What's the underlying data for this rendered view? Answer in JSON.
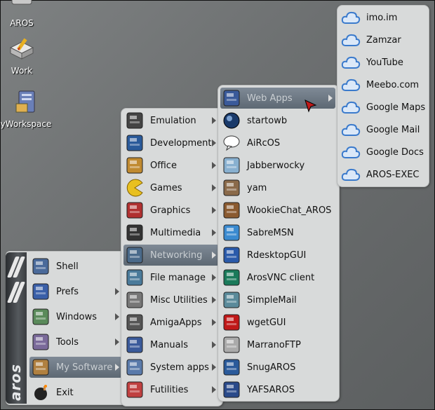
{
  "desktop": {
    "icons": [
      {
        "label": "AROS",
        "icon": "aros-drive-icon"
      },
      {
        "label": "Work",
        "icon": "work-drive-icon"
      },
      {
        "label": "yWorkspace",
        "icon": "workspace-drive-icon"
      }
    ]
  },
  "start_menu": {
    "brand": "aros",
    "items": [
      {
        "label": "Shell",
        "icon": "shell-icon",
        "submenu": false
      },
      {
        "label": "Prefs",
        "icon": "prefs-icon",
        "submenu": true
      },
      {
        "label": "Windows",
        "icon": "windows-icon",
        "submenu": true
      },
      {
        "label": "Tools",
        "icon": "tools-icon",
        "submenu": true
      },
      {
        "label": "My Software",
        "icon": "my-software-icon",
        "submenu": true,
        "selected": true
      },
      {
        "label": "Exit",
        "icon": "exit-icon",
        "submenu": false
      }
    ]
  },
  "software_menu": {
    "items": [
      {
        "label": "Emulation",
        "icon": "emulation-icon"
      },
      {
        "label": "Development",
        "icon": "development-icon"
      },
      {
        "label": "Office",
        "icon": "office-icon"
      },
      {
        "label": "Games",
        "icon": "games-icon"
      },
      {
        "label": "Graphics",
        "icon": "graphics-icon"
      },
      {
        "label": "Multimedia",
        "icon": "multimedia-icon"
      },
      {
        "label": "Networking",
        "icon": "networking-icon",
        "selected": true
      },
      {
        "label": "File manage",
        "icon": "file-manage-icon"
      },
      {
        "label": "Misc Utilities",
        "icon": "misc-utilities-icon"
      },
      {
        "label": "AmigaApps",
        "icon": "amigaapps-icon"
      },
      {
        "label": "Manuals",
        "icon": "manuals-icon"
      },
      {
        "label": "System apps",
        "icon": "system-apps-icon"
      },
      {
        "label": "Futilities",
        "icon": "futilities-icon"
      }
    ]
  },
  "networking_menu": {
    "items": [
      {
        "label": "Web Apps",
        "icon": "web-apps-icon",
        "submenu": true,
        "selected": true
      },
      {
        "label": "startowb",
        "icon": "startowb-icon"
      },
      {
        "label": "AiRcOS",
        "icon": "aircos-icon"
      },
      {
        "label": "Jabberwocky",
        "icon": "jabberwocky-icon"
      },
      {
        "label": "yam",
        "icon": "yam-icon"
      },
      {
        "label": "WookieChat_AROS",
        "icon": "wookiechat-icon"
      },
      {
        "label": "SabreMSN",
        "icon": "sabremsn-icon"
      },
      {
        "label": "RdesktopGUI",
        "icon": "rdesktopgui-icon"
      },
      {
        "label": "ArosVNC client",
        "icon": "arosvnc-icon"
      },
      {
        "label": "SimpleMail",
        "icon": "simplemail-icon"
      },
      {
        "label": "wgetGUI",
        "icon": "wgetgui-icon"
      },
      {
        "label": "MarranoFTP",
        "icon": "marranoftp-icon"
      },
      {
        "label": "SnugAROS",
        "icon": "snugaros-icon"
      },
      {
        "label": "YAFSAROS",
        "icon": "yafsaros-icon"
      }
    ]
  },
  "webapps_menu": {
    "items": [
      {
        "label": "imo.im",
        "icon": "cloud-icon"
      },
      {
        "label": "Zamzar",
        "icon": "cloud-icon"
      },
      {
        "label": "YouTube",
        "icon": "cloud-icon"
      },
      {
        "label": "Meebo.com",
        "icon": "cloud-icon"
      },
      {
        "label": "Google Maps",
        "icon": "cloud-icon"
      },
      {
        "label": "Google Mail",
        "icon": "cloud-icon"
      },
      {
        "label": "Google Docs",
        "icon": "cloud-icon"
      },
      {
        "label": "AROS-EXEC",
        "icon": "cloud-icon"
      }
    ]
  },
  "colors": {
    "desktop": "#6f7273",
    "menu_bg": "#d8dada",
    "selection": "#6b7580",
    "selection_text": "#c9ced2"
  }
}
